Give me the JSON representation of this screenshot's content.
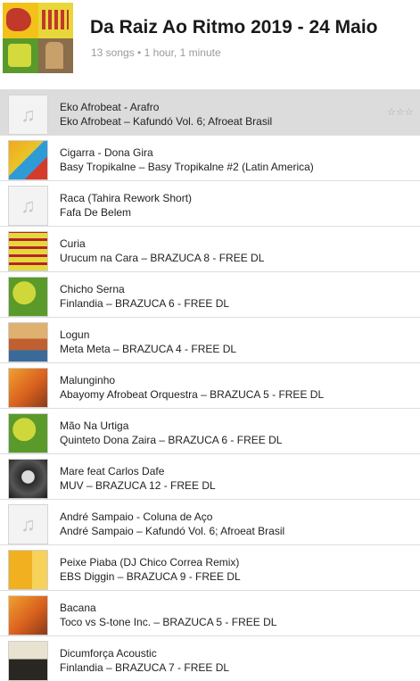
{
  "playlist": {
    "title": "Da Raiz Ao Ritmo 2019 - 24 Maio",
    "summary": "13 songs • 1 hour, 1 minute",
    "cover_label": "BRAZUCA6"
  },
  "colors": {
    "selected_row": "#dcdcdc",
    "divider": "#dedede",
    "subtitle": "#9a9a9a"
  },
  "rating_glyph": "☆☆☆",
  "songs": [
    {
      "title": "Eko Afrobeat - Arafro",
      "subtitle": "Eko Afrobeat – Kafundó Vol. 6;  Afroeat Brasil",
      "art": "placeholder",
      "selected": true
    },
    {
      "title": "Cigarra - Dona Gira",
      "subtitle": "Basy Tropikalne – Basy Tropikalne #2 (Latin America)",
      "art": "tropical"
    },
    {
      "title": "Raca (Tahira Rework Short)",
      "subtitle": "Fafa De Belem",
      "art": "placeholder"
    },
    {
      "title": "Curia",
      "subtitle": "Urucum na Cara – BRAZUCA 8 - FREE DL",
      "art": "urucum"
    },
    {
      "title": "Chicho Serna",
      "subtitle": "Finlandia – BRAZUCA 6 - FREE DL",
      "art": "brazuca6"
    },
    {
      "title": "Logun",
      "subtitle": "Meta Meta – BRAZUCA 4 - FREE DL",
      "art": "brazuca4"
    },
    {
      "title": "Malunginho",
      "subtitle": "Abayomy Afrobeat Orquestra – BRAZUCA 5 - FREE DL",
      "art": "brazuca5"
    },
    {
      "title": "Mão Na Urtiga",
      "subtitle": "Quinteto Dona Zaira – BRAZUCA 6 - FREE DL",
      "art": "brazuca6"
    },
    {
      "title": "Mare feat Carlos Dafe",
      "subtitle": "MUV – BRAZUCA 12 - FREE DL",
      "art": "brazuca12"
    },
    {
      "title": "André Sampaio - Coluna de Aço",
      "subtitle": "André Sampaio – Kafundó Vol. 6;  Afroeat Brasil",
      "art": "placeholder"
    },
    {
      "title": "Peixe Piaba (DJ Chico Correa Remix)",
      "subtitle": "EBS Diggin – BRAZUCA 9 - FREE DL",
      "art": "brazuca9"
    },
    {
      "title": "Bacana",
      "subtitle": "Toco vs S-tone Inc. – BRAZUCA 5 - FREE DL",
      "art": "brazuca5"
    },
    {
      "title": "Dicumforça Acoustic",
      "subtitle": "Finlandia – BRAZUCA 7 - FREE DL",
      "art": "brazuca7"
    }
  ]
}
